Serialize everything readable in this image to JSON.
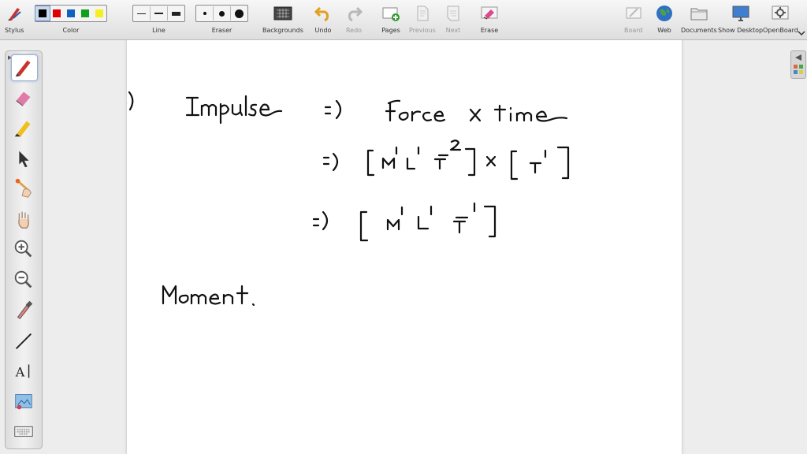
{
  "toolbar": {
    "stylus": "Stylus",
    "color": "Color",
    "line": "Line",
    "eraser": "Eraser",
    "backgrounds": "Backgrounds",
    "undo": "Undo",
    "redo": "Redo",
    "pages": "Pages",
    "previous": "Previous",
    "next": "Next",
    "erase": "Erase",
    "board": "Board",
    "web": "Web",
    "documents": "Documents",
    "show_desktop": "Show Desktop",
    "openboard": "OpenBoard"
  },
  "colors": {
    "swatches": [
      "#000000",
      "#e00000",
      "#1060c0",
      "#10a020",
      "#f4ef20"
    ],
    "selected_index": 0,
    "ink": "#111111"
  },
  "icons": {
    "sidebar": [
      "pen-icon",
      "eraser-icon",
      "marker-icon",
      "pointer-icon",
      "laser-pointer-icon",
      "hand-icon",
      "zoom-in-icon",
      "zoom-out-icon",
      "color-picker-icon",
      "line-tool-icon",
      "text-tool-icon",
      "capture-icon",
      "keyboard-icon"
    ]
  },
  "board": {
    "lines": [
      {
        "part": "(c)"
      },
      {
        "label": "Impulse",
        "sym": "=)",
        "expr": "Force x time"
      },
      {
        "sym": "=)",
        "expr": "[M¹L¹T⁻²] x [T¹]"
      },
      {
        "sym": "=)",
        "expr": "[M¹L¹T⁻¹]"
      },
      {
        "label": "Moment."
      }
    ]
  }
}
